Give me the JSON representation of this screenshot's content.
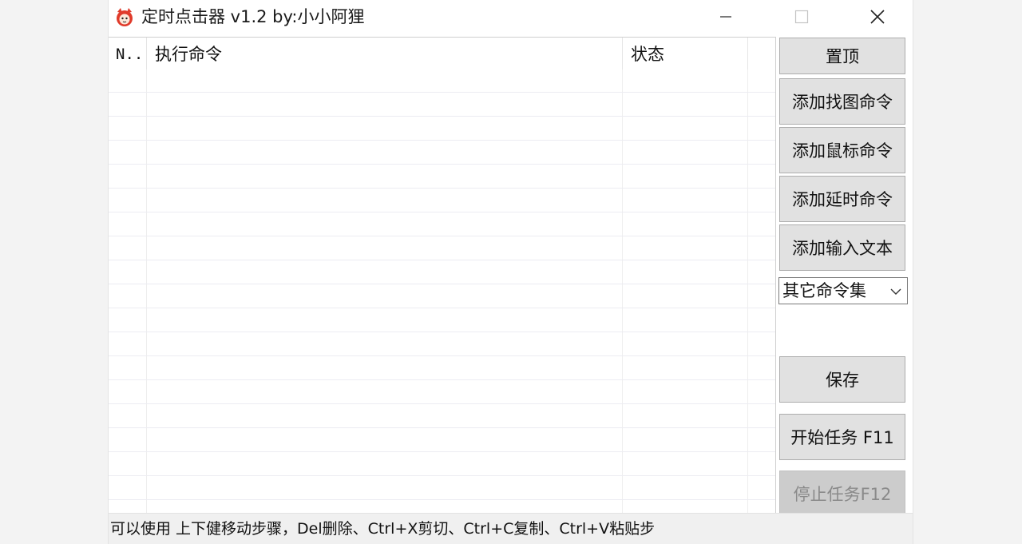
{
  "window": {
    "title": "定时点击器 v1.2 by:小小阿狸",
    "icon": "fox-mascot-icon"
  },
  "list": {
    "columns": [
      "N..",
      "执行命令",
      "状态"
    ],
    "rows": []
  },
  "buttons": {
    "pin_top": "置顶",
    "add_find_image": "添加找图命令",
    "add_mouse": "添加鼠标命令",
    "add_delay": "添加延时命令",
    "add_input_text": "添加输入文本",
    "save": "保存",
    "start_task": "开始任务 F11",
    "stop_task": "停止任务F12"
  },
  "dropdown": {
    "selected": "其它命令集"
  },
  "statusbar": {
    "text": "可以使用 上下健移动步骤，Del删除、Ctrl+X剪切、Ctrl+C复制、Ctrl+V粘贴步"
  },
  "colors": {
    "accent_icon": "#e03a2a",
    "button_bg": "#e1e1e1",
    "disabled_text": "#8a8a8a"
  }
}
